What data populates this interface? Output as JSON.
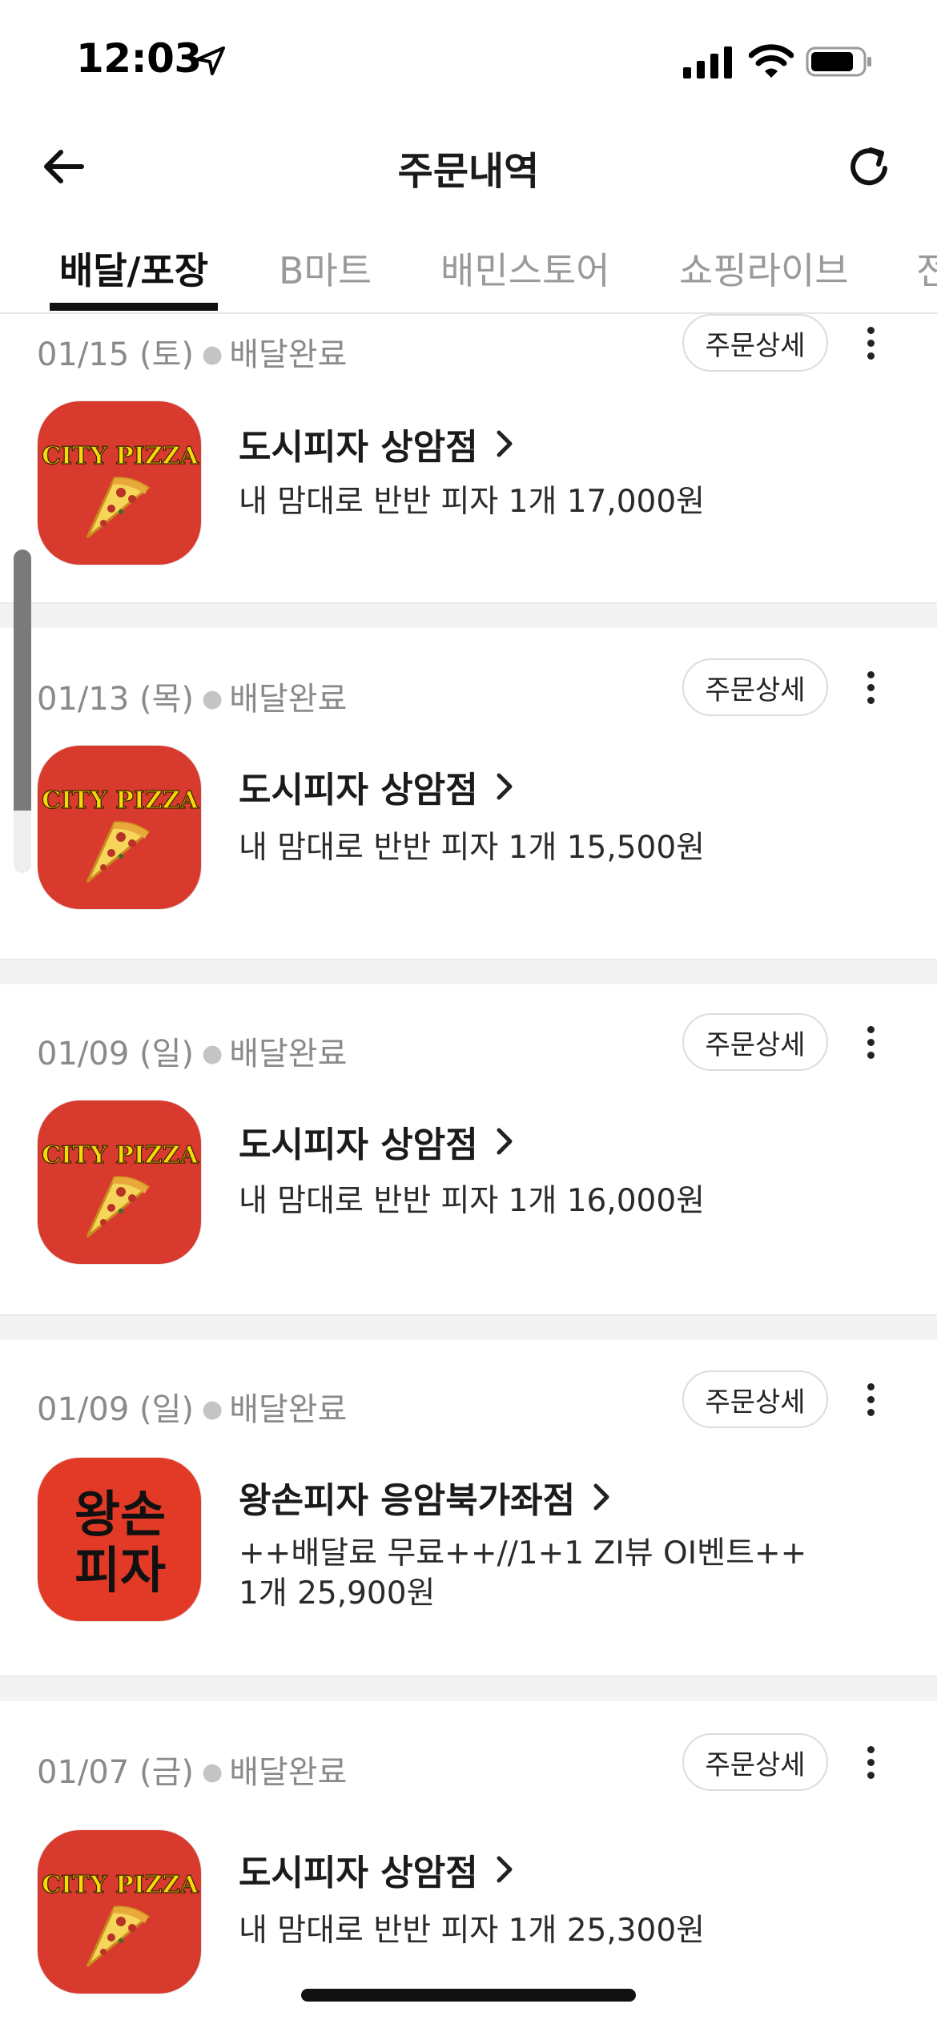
{
  "status_bar": {
    "time": "12:03"
  },
  "header": {
    "title": "주문내역",
    "back_icon": "arrow-left-icon",
    "refresh_icon": "refresh-icon"
  },
  "tabs": [
    {
      "label": "배달/포장",
      "active": true
    },
    {
      "label": "B마트",
      "active": false
    },
    {
      "label": "배민스토어",
      "active": false
    },
    {
      "label": "쇼핑라이브",
      "active": false
    },
    {
      "label": "전",
      "active": false
    }
  ],
  "detail_button_label": "주문상세",
  "orders": [
    {
      "date": "01/15 (토)",
      "status": "배달완료",
      "store": "도시피자 상암점",
      "menu_line1": "내 맘대로 반반 피자 1개 17,000원",
      "menu_line2": "",
      "logo": {
        "type": "city-pizza",
        "text": "CITY PIZZA"
      }
    },
    {
      "date": "01/13 (목)",
      "status": "배달완료",
      "store": "도시피자 상암점",
      "menu_line1": "내 맘대로 반반 피자 1개 15,500원",
      "menu_line2": "",
      "logo": {
        "type": "city-pizza",
        "text": "CITY PIZZA"
      }
    },
    {
      "date": "01/09 (일)",
      "status": "배달완료",
      "store": "도시피자 상암점",
      "menu_line1": "내 맘대로 반반 피자 1개 16,000원",
      "menu_line2": "",
      "logo": {
        "type": "city-pizza",
        "text": "CITY PIZZA"
      }
    },
    {
      "date": "01/09 (일)",
      "status": "배달완료",
      "store": "왕손피자 응암북가좌점",
      "menu_line1": "++배달료 무료++//1+1 ZI뷰 OI벤트++",
      "menu_line2": "1개 25,900원",
      "logo": {
        "type": "wangson-pizza",
        "line1": "왕손",
        "line2": "피자"
      }
    },
    {
      "date": "01/07 (금)",
      "status": "배달완료",
      "store": "도시피자 상암점",
      "menu_line1": "내 맘대로 반반 피자 1개 25,300원",
      "menu_line2": "",
      "logo": {
        "type": "city-pizza",
        "text": "CITY PIZZA"
      }
    }
  ],
  "colors": {
    "logo_red": "#d83a2e",
    "logo_yellow": "#f5d90a",
    "secondary_text": "#8a8a8a",
    "separator": "#f3f3f3"
  }
}
